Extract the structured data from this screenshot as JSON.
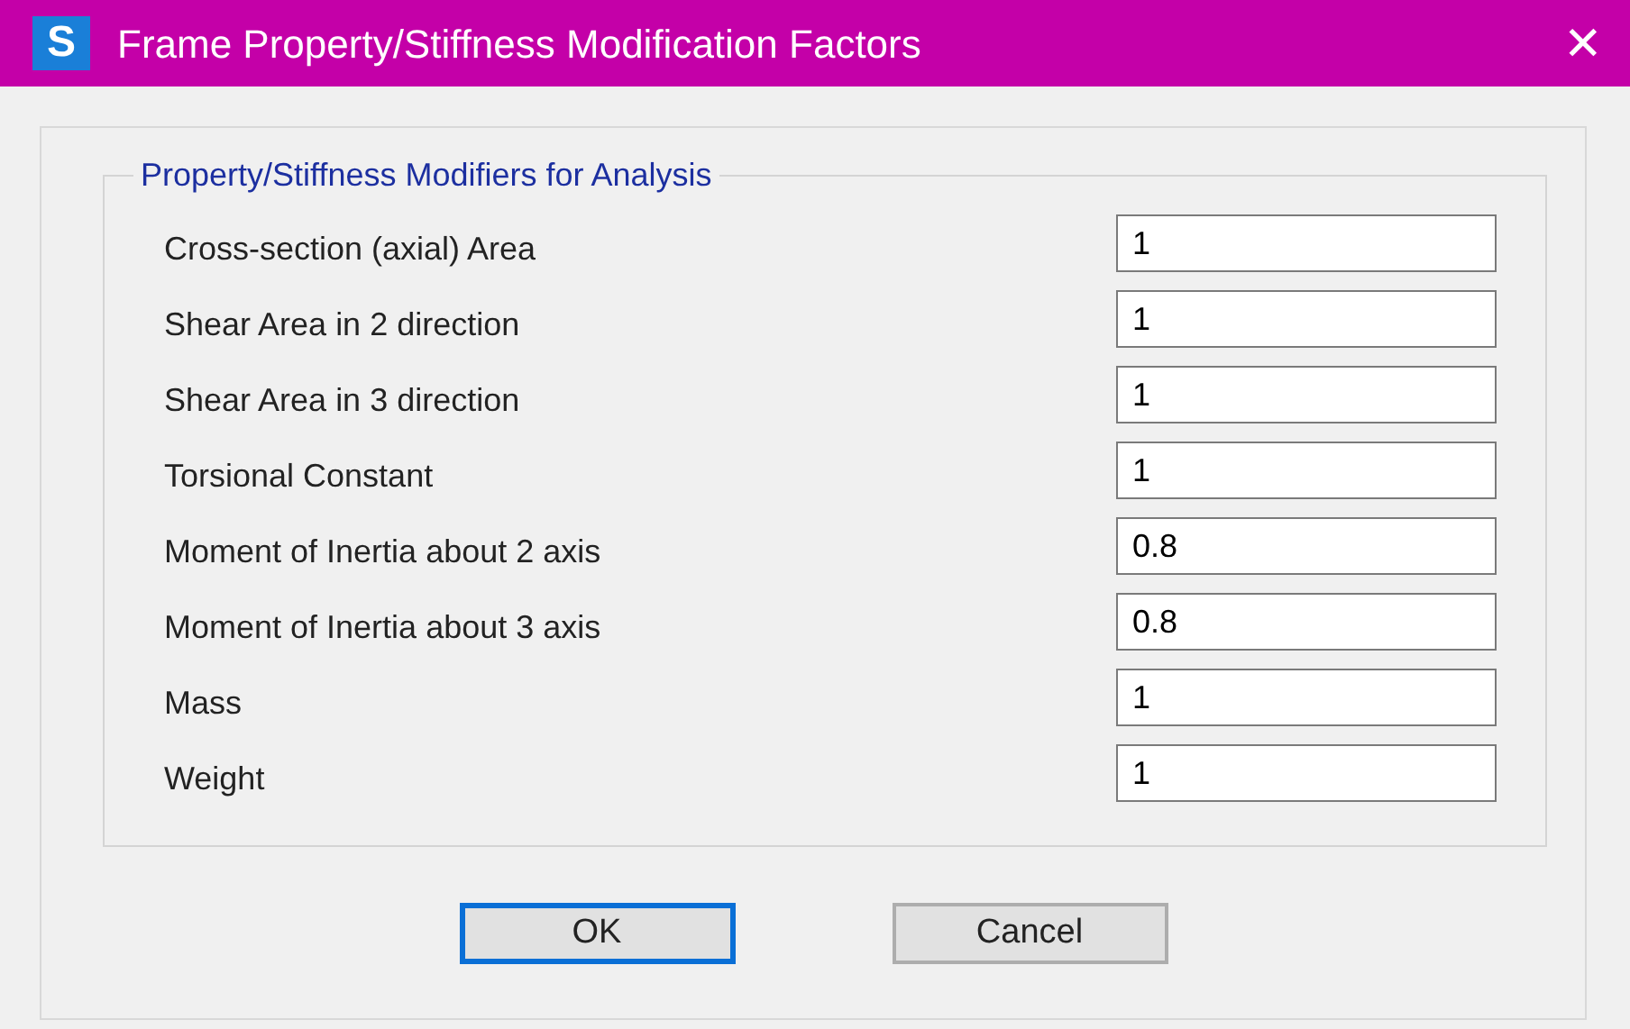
{
  "window": {
    "title": "Frame Property/Stiffness Modification Factors",
    "close": "✕",
    "icon_letter": "S"
  },
  "group": {
    "title": "Property/Stiffness Modifiers for Analysis",
    "fields": [
      {
        "label": "Cross-section (axial) Area",
        "value": "1"
      },
      {
        "label": "Shear Area in 2 direction",
        "value": "1"
      },
      {
        "label": "Shear Area in 3 direction",
        "value": "1"
      },
      {
        "label": "Torsional Constant",
        "value": "1"
      },
      {
        "label": "Moment of Inertia about 2 axis",
        "value": "0.8"
      },
      {
        "label": "Moment of Inertia about 3 axis",
        "value": "0.8"
      },
      {
        "label": "Mass",
        "value": "1"
      },
      {
        "label": "Weight",
        "value": "1"
      }
    ]
  },
  "buttons": [
    {
      "label": "OK",
      "focused": true
    },
    {
      "label": "Cancel",
      "focused": false
    }
  ]
}
